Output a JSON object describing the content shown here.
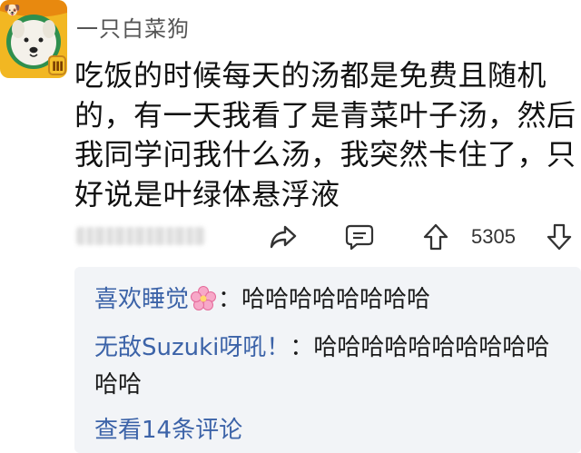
{
  "user": {
    "name": "一只白菜狗",
    "avatar_icon": "dog-avatar-icon"
  },
  "post": {
    "text": "吃饭的时候每天的汤都是免费且随机的，有一天我看了是青菜叶子汤，然后我同学问我什么汤，我突然卡住了，只好说是叶绿体悬浮液"
  },
  "actions": {
    "share_icon": "share-icon",
    "comment_icon": "comment-icon",
    "upvote_icon": "upvote-icon",
    "vote_count": "5305",
    "downvote_icon": "downvote-icon"
  },
  "comments": [
    {
      "author": "喜欢睡觉",
      "emoji": "cherry-blossom-icon",
      "separator": "：",
      "text": "哈哈哈哈哈哈哈哈"
    },
    {
      "author": "无敌Suzuki呀吼！",
      "separator": "：",
      "text": "哈哈哈哈哈哈哈哈哈哈哈哈"
    }
  ],
  "view_more": "查看14条评论",
  "colors": {
    "link": "#3c63a8",
    "comment_bg": "#f2f4f7",
    "text": "#111111"
  }
}
